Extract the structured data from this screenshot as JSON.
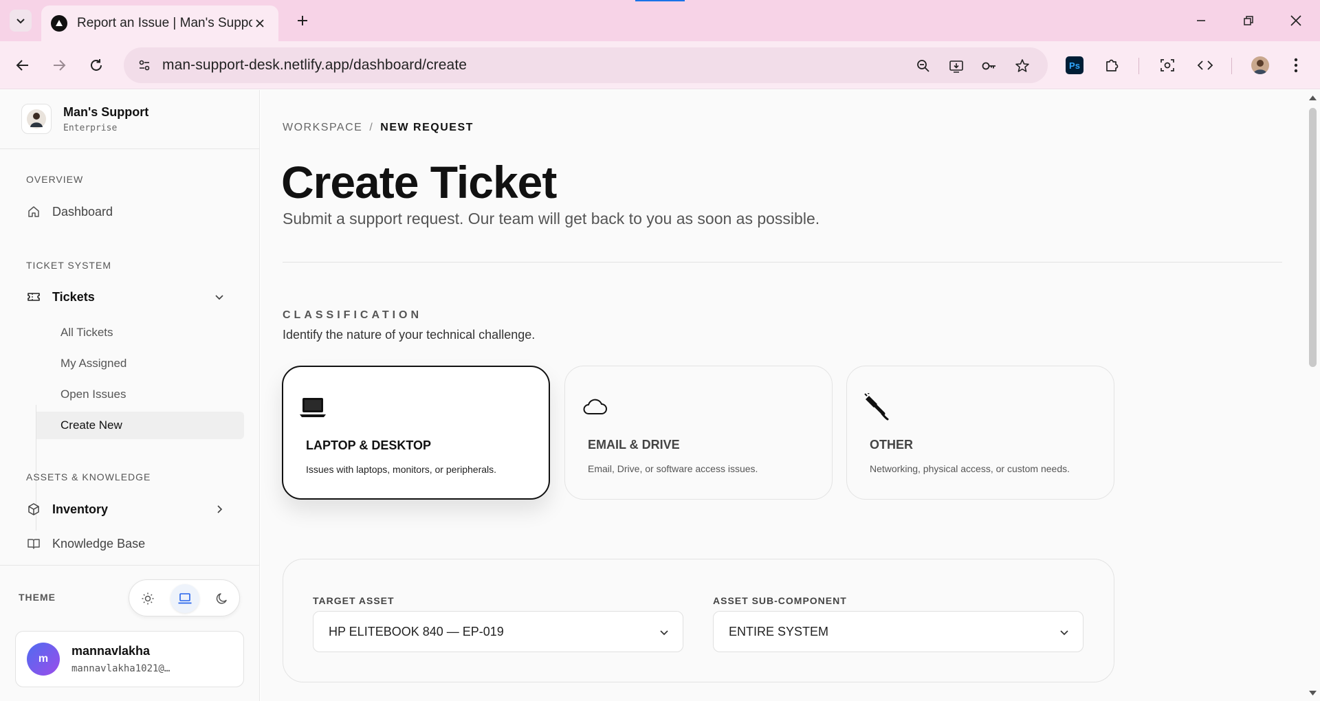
{
  "browser": {
    "tab_title": "Report an Issue | Man's Support Desk",
    "url": "man-support-desk.netlify.app/dashboard/create"
  },
  "sidebar": {
    "brand_name": "Man's Support",
    "brand_sub": "Enterprise",
    "sections": {
      "overview": "OVERVIEW",
      "ticket_system": "TICKET SYSTEM",
      "assets": "ASSETS & KNOWLEDGE"
    },
    "items": {
      "dashboard": "Dashboard",
      "tickets": "Tickets",
      "inventory": "Inventory",
      "knowledge_base": "Knowledge Base"
    },
    "ticket_sub": [
      "All Tickets",
      "My Assigned",
      "Open Issues",
      "Create New"
    ],
    "theme_label": "THEME",
    "theme_active": "system",
    "user": {
      "initial": "m",
      "name": "mannavlakha",
      "email": "mannavlakha1021@…"
    }
  },
  "main": {
    "breadcrumb": {
      "root": "WORKSPACE",
      "sep": "/",
      "current": "NEW REQUEST"
    },
    "title": "Create Ticket",
    "subtitle": "Submit a support request. Our team will get back to you as soon as possible.",
    "classification": {
      "label": "CLASSIFICATION",
      "description": "Identify the nature of your technical challenge.",
      "categories": [
        {
          "title": "LAPTOP & DESKTOP",
          "desc": "Issues with laptops, monitors, or peripherals.",
          "icon": "laptop-icon",
          "selected": true
        },
        {
          "title": "EMAIL & DRIVE",
          "desc": "Email, Drive, or software access issues.",
          "icon": "cloud-icon",
          "selected": false
        },
        {
          "title": "OTHER",
          "desc": "Networking, physical access, or custom needs.",
          "icon": "cable-icon",
          "selected": false
        }
      ]
    },
    "asset": {
      "target_label": "TARGET ASSET",
      "target_value": "HP ELITEBOOK 840 — EP-019",
      "sub_label": "ASSET SUB-COMPONENT",
      "sub_value": "ENTIRE SYSTEM"
    }
  },
  "colors": {
    "chrome_tab_bar": "#f7d3e7",
    "chrome_toolbar": "#fbeaf3",
    "accent": "#111111",
    "avatar_gradient_start": "#4f6cf0",
    "avatar_gradient_end": "#9b4dea"
  }
}
